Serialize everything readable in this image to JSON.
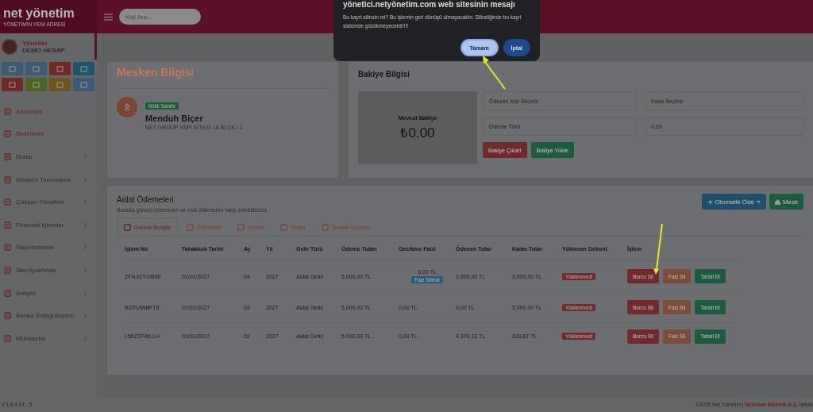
{
  "header": {
    "logo": "net yönetim",
    "logo_tagline": "YÖNETİMİN YENİ ADRESİ",
    "search": {
      "placeholder": "Kişi Ara..."
    }
  },
  "user": {
    "role": "Yönetici",
    "name": "DEMO HESAP"
  },
  "quick_tiles": [
    {
      "color": "#3d5a73"
    },
    {
      "color": "#3d5a73"
    },
    {
      "color": "#6e2a25"
    },
    {
      "color": "#1f5569"
    },
    {
      "color": "#6e2a25"
    },
    {
      "color": "#4c6328"
    },
    {
      "color": "#6e5420"
    },
    {
      "color": "#3d5a73"
    }
  ],
  "sidebar": {
    "items": [
      {
        "label": "Anasayfa",
        "expandable": false,
        "highlighted": true
      },
      {
        "label": "Bildirimler",
        "expandable": false,
        "highlighted": true
      },
      {
        "label": "Notlar",
        "expandable": true,
        "highlighted": false
      },
      {
        "label": "Mesken Tanımlama",
        "expandable": true,
        "highlighted": false
      },
      {
        "label": "Çalışan Yönetimi",
        "expandable": true,
        "highlighted": false
      },
      {
        "label": "Finansal İşlemler",
        "expandable": true,
        "highlighted": false
      },
      {
        "label": "Raporlamalar",
        "expandable": true,
        "highlighted": false
      },
      {
        "label": "Site/Apartman",
        "expandable": true,
        "highlighted": false
      },
      {
        "label": "İletişim",
        "expandable": true,
        "highlighted": false
      },
      {
        "label": "Banka Entegrasyonu",
        "expandable": true,
        "highlighted": false
      },
      {
        "label": "Muhasebe",
        "expandable": true,
        "highlighted": false
      }
    ]
  },
  "mesken": {
    "title": "Mesken Bilgisi",
    "badge": "Mülk Sahibi",
    "name": "Menduh Biçer",
    "address": "NET GROUP YAPI SİTESİ / A BLOK / 1"
  },
  "bakiye": {
    "title": "Bakiye Bilgisi",
    "balance_label": "Mevcut Bakiye",
    "balance": "₺0.00",
    "fields": [
      {
        "placeholder": "Ödeyen Kişi Seçiniz"
      },
      {
        "placeholder": "Kasa Seçiniz"
      },
      {
        "placeholder": "Ödeme Türü"
      },
      {
        "placeholder": "0.00"
      }
    ],
    "buttons": [
      {
        "label": "Bakiye Çıkart",
        "kind": "danger"
      },
      {
        "label": "Bakiye Yükle",
        "kind": "success"
      }
    ]
  },
  "aidat": {
    "title": "Aidat Ödemeleri",
    "subtitle": "Burada güncel ödemeleri ve eski ödemeleri takip edebilirsiniz",
    "actions": [
      {
        "label": "Otomatik Öde",
        "kind": "primary"
      },
      {
        "label": "Mesk",
        "kind": "success"
      }
    ],
    "tabs": [
      {
        "label": "Güncel Borçlar",
        "selected": true
      },
      {
        "label": "Ödemeler",
        "selected": false
      },
      {
        "label": "İadeler",
        "selected": false
      },
      {
        "label": "Notlar",
        "selected": false
      },
      {
        "label": "Bakiye Geçmişi",
        "selected": false
      }
    ],
    "columns": [
      "İşlem No",
      "Tahakkuk Tarihi",
      "Ay",
      "Yıl",
      "Gelir Türü",
      "Ödeme Tutarı",
      "Gecikme Faizi",
      "Ödenen Tutar",
      "Kalan Tutar",
      "Yüklenen Dekont",
      "İşlem"
    ],
    "rows": [
      {
        "cells": [
          "ZFNJGYGB9E",
          "01/01/2027",
          "04",
          "2027",
          "Aidat Geliri",
          "5.000,00 TL",
          "0,00 TL",
          "2.000,00 TL",
          "3.000,00 TL"
        ],
        "faiz_note": "Faiz Silindi",
        "dekont": "Yüklenmedi",
        "buttons": [
          "Borcu Sil",
          "Faiz Sil",
          "Tahsil Et"
        ]
      },
      {
        "cells": [
          "BI2FUWBFT8",
          "01/01/2027",
          "03",
          "2027",
          "Aidat Geliri",
          "5.000,00 TL",
          "0,00 TL",
          "0,00 TL",
          "5.000,00 TL"
        ],
        "dekont": "Yüklenmedi",
        "buttons": [
          "Borcu Sil",
          "Faiz Sil",
          "Tahsil Et"
        ]
      },
      {
        "cells": [
          "L56ZZFWLLH",
          "01/01/2027",
          "02",
          "2027",
          "Aidat Geliri",
          "5.000,00 TL",
          "0,00 TL",
          "4.379,13 TL",
          "620,87 TL"
        ],
        "dekont": "Yüklenmedi",
        "buttons": [
          "Borcu Sil",
          "Faiz Sil",
          "Tahsil Et"
        ]
      }
    ]
  },
  "footer": {
    "version": "V.1.8.4.01 - 5",
    "copyright": "©2025 Net Yönetim | ",
    "company": "Netelsan Elektrik A.Ş.",
    "affiliate": " İştirak"
  },
  "dialog": {
    "title": "yönetici.netyönetim.com web sitesinin mesajı",
    "message": "Bu kayıt silinsin mi? Bu işlemin geri dönüşü olmayacaktır. Silindiğinde bu kayıt sistemde gözükmeyecektir!!!",
    "buttons": [
      {
        "label": "Tamam",
        "kind": "primary"
      },
      {
        "label": "İptal",
        "kind": "secondary"
      }
    ]
  }
}
